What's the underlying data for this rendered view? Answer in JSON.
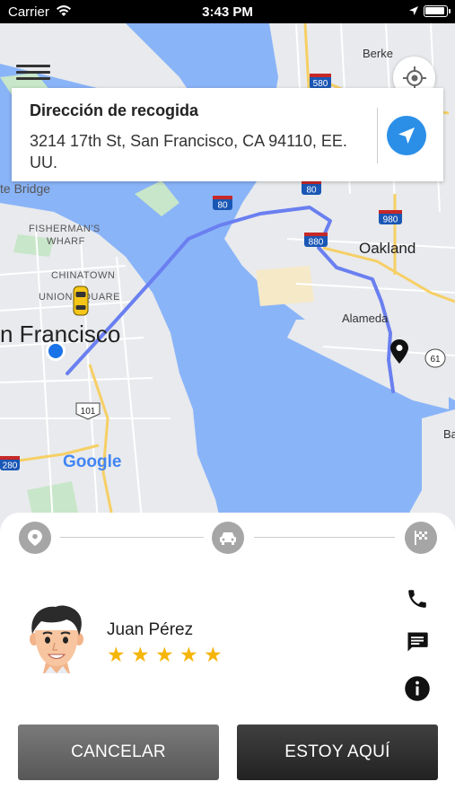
{
  "status_bar": {
    "carrier": "Carrier",
    "time": "3:43 PM"
  },
  "map": {
    "labels": {
      "berkeley": "Berke",
      "gate_bridge": "te Bridge",
      "fishermans_wharf_1": "FISHERMAN'S",
      "fishermans_wharf_2": "WHARF",
      "chinatown": "CHINATOWN",
      "union_square": "UNION SQUARE",
      "san_francisco": "n Francisco",
      "oakland": "Oakland",
      "alameda": "Alameda",
      "ba": "Ba",
      "google": "Google"
    },
    "highway_shields": [
      "580",
      "80",
      "80",
      "880",
      "980",
      "61",
      "101",
      "280"
    ],
    "route_color": "#6a7ff0",
    "water_color": "#8ab4f8",
    "land_color": "#e8eaed",
    "park_color": "#c8e6c9"
  },
  "pickup": {
    "title": "Dirección de recogida",
    "address": "3214 17th St, San Francisco, CA 94110, EE. UU."
  },
  "progress": {
    "steps": [
      "pickup-pin-icon",
      "car-icon",
      "finish-flag-icon"
    ]
  },
  "driver": {
    "name": "Juan Pérez",
    "rating": 5
  },
  "actions": {
    "call": "phone-icon",
    "message": "message-icon",
    "info": "info-icon"
  },
  "buttons": {
    "cancel": "CANCELAR",
    "here": "ESTOY AQUÍ"
  },
  "colors": {
    "accent": "#2b8fe8",
    "star": "#f5b50a",
    "taxi": "#f5c518"
  }
}
